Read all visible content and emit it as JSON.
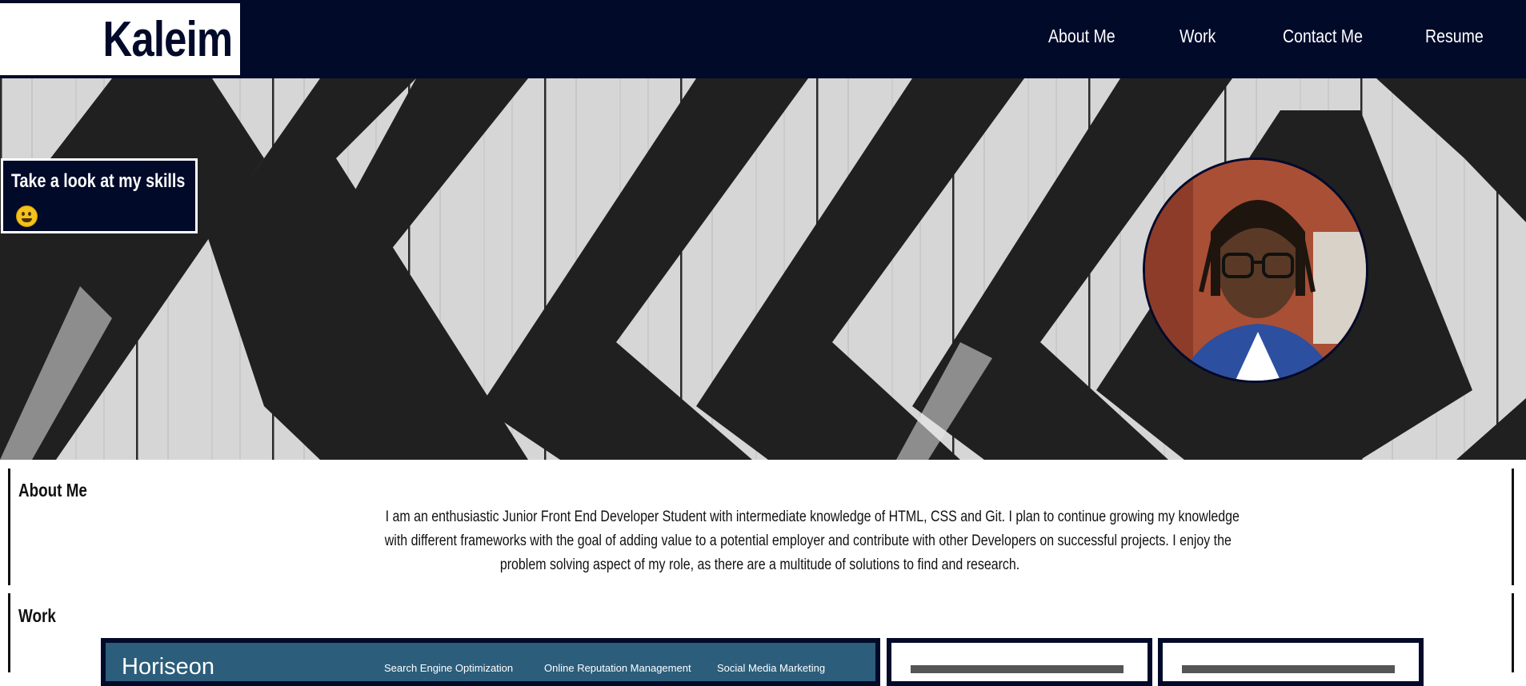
{
  "brand": {
    "name": "Kaleim"
  },
  "nav": {
    "items": [
      {
        "label": "About Me"
      },
      {
        "label": "Work"
      },
      {
        "label": "Contact Me"
      },
      {
        "label": "Resume"
      }
    ]
  },
  "hero": {
    "skills_label": "Take a look at my skills",
    "skills_emoji": "grinning-face-icon"
  },
  "about": {
    "title": "About Me",
    "lines": [
      "I am an enthusiastic Junior Front End Developer Student with intermediate knowledge of HTML, CSS and Git. I plan to continue growing my knowledge",
      "with different frameworks with the goal of adding value to a potential employer and contribute with other Developers on successful projects. I enjoy the",
      "problem solving aspect of my role, as there are a multitude of solutions to find and research."
    ]
  },
  "work": {
    "title": "Work",
    "featured": {
      "logo": "Horiseon",
      "menu": [
        "Search Engine Optimization",
        "Online Reputation Management",
        "Social Media Marketing"
      ]
    }
  },
  "colors": {
    "navy": "#020a2a",
    "white": "#ffffff",
    "horiseon_blue": "#2c5d7b"
  }
}
